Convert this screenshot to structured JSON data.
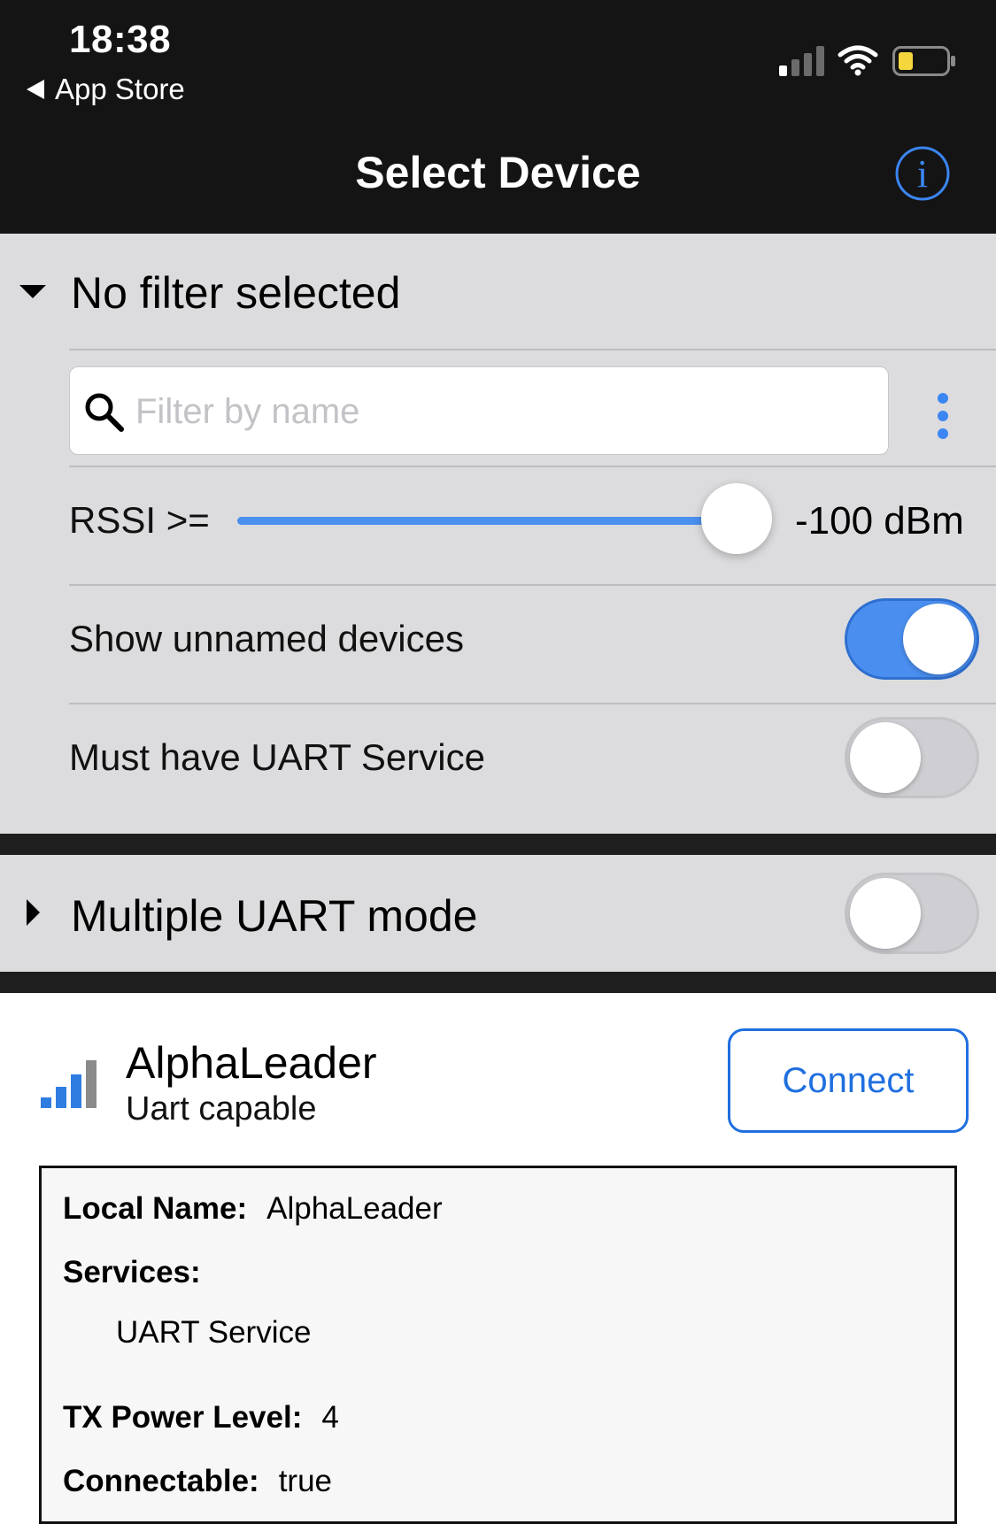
{
  "status_bar": {
    "time": "18:38",
    "back_app": "App Store",
    "battery_color": "#f5d63d"
  },
  "nav": {
    "title": "Select Device",
    "info_icon": "info-circle-icon",
    "accent": "#3b86f2"
  },
  "filter": {
    "header": "No filter selected",
    "search_placeholder": "Filter by name",
    "search_value": "",
    "rssi_label": "RSSI >=",
    "rssi_value": "-100 dBm",
    "rssi_slider_fraction": 0.95,
    "show_unnamed_label": "Show unnamed devices",
    "show_unnamed_on": true,
    "must_have_uart_label": "Must have UART Service",
    "must_have_uart_on": false
  },
  "multi_uart": {
    "label": "Multiple UART mode",
    "on": false
  },
  "device": {
    "name": "AlphaLeader",
    "subtitle": "Uart capable",
    "connect_label": "Connect",
    "signal_bars_active": 3,
    "signal_bars_total": 4,
    "details": {
      "local_name_key": "Local Name:",
      "local_name_value": "AlphaLeader",
      "services_key": "Services:",
      "services": [
        "UART Service"
      ],
      "tx_power_key": "TX Power Level:",
      "tx_power_value": "4",
      "connectable_key": "Connectable:",
      "connectable_value": "true"
    }
  }
}
